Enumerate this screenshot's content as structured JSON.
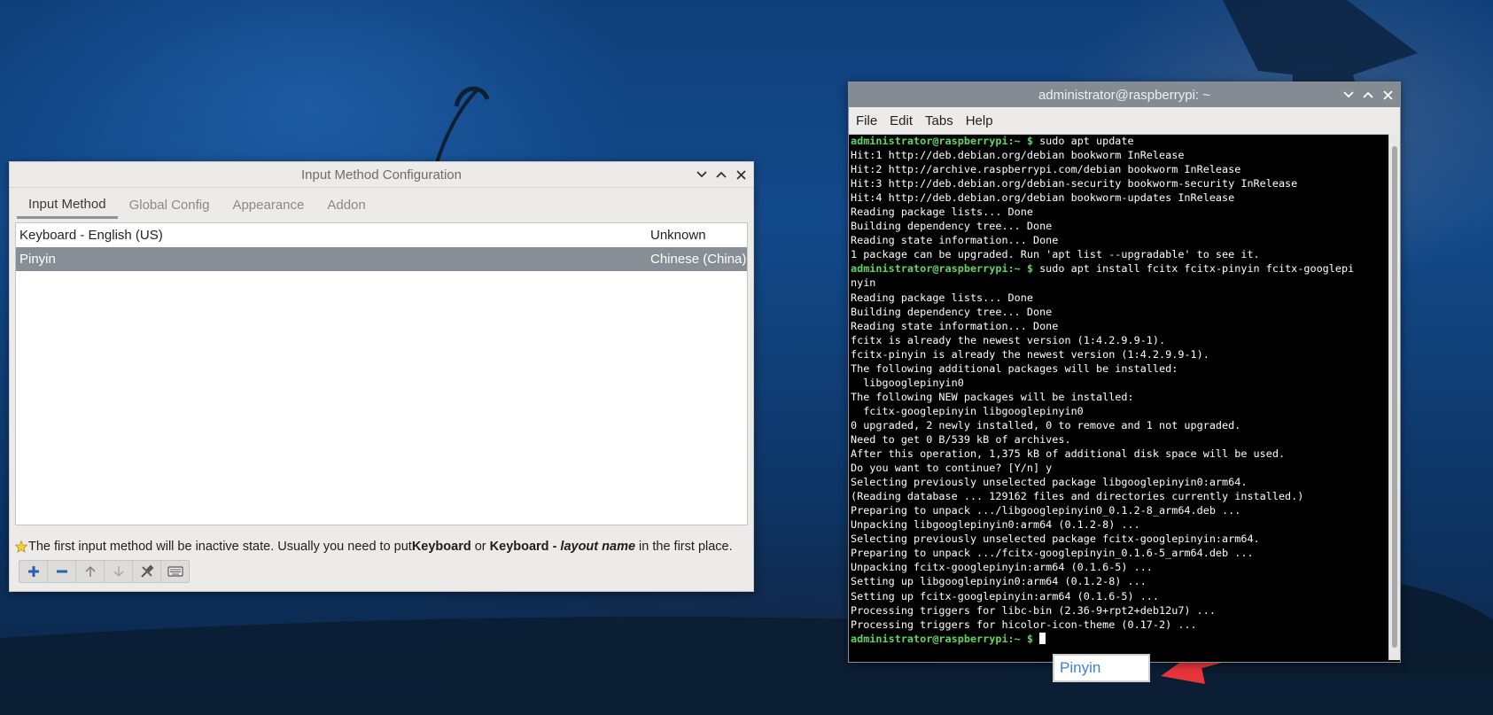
{
  "imc_window": {
    "title": "Input Method Configuration",
    "tabs": [
      {
        "label": "Input Method",
        "active": true
      },
      {
        "label": "Global Config",
        "active": false
      },
      {
        "label": "Appearance",
        "active": false
      },
      {
        "label": "Addon",
        "active": false
      }
    ],
    "methods": [
      {
        "name": "Keyboard - English (US)",
        "language": "Unknown",
        "selected": false
      },
      {
        "name": "Pinyin",
        "language": "Chinese (China)",
        "selected": true
      }
    ],
    "note": {
      "part1": "The first input method will be inactive state. Usually you need to put ",
      "bold1": "Keyboard",
      "part2": " or ",
      "bold2": "Keyboard - ",
      "italic": "layout name",
      "part3": " in the first place."
    },
    "toolbar_icons": [
      "add-icon",
      "remove-icon",
      "move-up-icon",
      "move-down-icon",
      "configure-icon",
      "keyboard-layout-icon"
    ]
  },
  "terminal_window": {
    "title": "administrator@raspberrypi: ~",
    "menu": [
      "File",
      "Edit",
      "Tabs",
      "Help"
    ],
    "prompt": "administrator@raspberrypi",
    "prompt_suffix": ":~ $ ",
    "lines": [
      {
        "type": "cmd",
        "text": "sudo apt update"
      },
      {
        "type": "out",
        "text": "Hit:1 http://deb.debian.org/debian bookworm InRelease"
      },
      {
        "type": "out",
        "text": "Hit:2 http://archive.raspberrypi.com/debian bookworm InRelease"
      },
      {
        "type": "out",
        "text": "Hit:3 http://deb.debian.org/debian-security bookworm-security InRelease"
      },
      {
        "type": "out",
        "text": "Hit:4 http://deb.debian.org/debian bookworm-updates InRelease"
      },
      {
        "type": "out",
        "text": "Reading package lists... Done"
      },
      {
        "type": "out",
        "text": "Building dependency tree... Done"
      },
      {
        "type": "out",
        "text": "Reading state information... Done"
      },
      {
        "type": "out",
        "text": "1 package can be upgraded. Run 'apt list --upgradable' to see it."
      },
      {
        "type": "cmd",
        "text": "sudo apt install fcitx fcitx-pinyin fcitx-googlepi"
      },
      {
        "type": "out",
        "text": "nyin"
      },
      {
        "type": "out",
        "text": "Reading package lists... Done"
      },
      {
        "type": "out",
        "text": "Building dependency tree... Done"
      },
      {
        "type": "out",
        "text": "Reading state information... Done"
      },
      {
        "type": "out",
        "text": "fcitx is already the newest version (1:4.2.9.9-1)."
      },
      {
        "type": "out",
        "text": "fcitx-pinyin is already the newest version (1:4.2.9.9-1)."
      },
      {
        "type": "out",
        "text": "The following additional packages will be installed:"
      },
      {
        "type": "out",
        "text": "  libgooglepinyin0"
      },
      {
        "type": "out",
        "text": "The following NEW packages will be installed:"
      },
      {
        "type": "out",
        "text": "  fcitx-googlepinyin libgooglepinyin0"
      },
      {
        "type": "out",
        "text": "0 upgraded, 2 newly installed, 0 to remove and 1 not upgraded."
      },
      {
        "type": "out",
        "text": "Need to get 0 B/539 kB of archives."
      },
      {
        "type": "out",
        "text": "After this operation, 1,375 kB of additional disk space will be used."
      },
      {
        "type": "out",
        "text": "Do you want to continue? [Y/n] y"
      },
      {
        "type": "out",
        "text": "Selecting previously unselected package libgooglepinyin0:arm64."
      },
      {
        "type": "out",
        "text": "(Reading database ... 129162 files and directories currently installed.)"
      },
      {
        "type": "out",
        "text": "Preparing to unpack .../libgooglepinyin0_0.1.2-8_arm64.deb ..."
      },
      {
        "type": "out",
        "text": "Unpacking libgooglepinyin0:arm64 (0.1.2-8) ..."
      },
      {
        "type": "out",
        "text": "Selecting previously unselected package fcitx-googlepinyin:arm64."
      },
      {
        "type": "out",
        "text": "Preparing to unpack .../fcitx-googlepinyin_0.1.6-5_arm64.deb ..."
      },
      {
        "type": "out",
        "text": "Unpacking fcitx-googlepinyin:arm64 (0.1.6-5) ..."
      },
      {
        "type": "out",
        "text": "Setting up libgooglepinyin0:arm64 (0.1.2-8) ..."
      },
      {
        "type": "out",
        "text": "Setting up fcitx-googlepinyin:arm64 (0.1.6-5) ..."
      },
      {
        "type": "out",
        "text": "Processing triggers for libc-bin (2.36-9+rpt2+deb12u7) ..."
      },
      {
        "type": "out",
        "text": "Processing triggers for hicolor-icon-theme (0.17-2) ..."
      },
      {
        "type": "prompt",
        "text": ""
      }
    ]
  },
  "ime_indicator": {
    "label": "Pinyin"
  },
  "colors": {
    "prompt_green": "#5fd75f",
    "selection_gray": "#878e95",
    "annotation_red": "#e8353b",
    "ime_text_blue": "#3f7fd4"
  }
}
